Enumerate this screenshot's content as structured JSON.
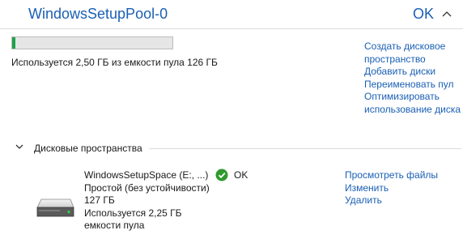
{
  "pool": {
    "name": "WindowsSetupPool-0",
    "status": "OK",
    "usage_fraction": 0.0198,
    "usage_text": "Используется 2,50 ГБ из емкости пула 126 ГБ",
    "actions": [
      "Создать дисковое пространство",
      "Добавить диски",
      "Переименовать пул",
      "Оптимизировать использование диска"
    ]
  },
  "section": {
    "title": "Дисковые пространства"
  },
  "space": {
    "name": "WindowsSetupSpace (E:, ...)",
    "resiliency": "Простой (без устойчивости)",
    "size": "127 ГБ",
    "usage": "Используется 2,25 ГБ емкости пула",
    "status": "OK",
    "actions": [
      "Просмотреть файлы",
      "Изменить",
      "Удалить"
    ]
  },
  "colors": {
    "accent": "#1a5fb4",
    "progress_fill": "#1fa34a",
    "ok_badge": "#2e9a2e"
  },
  "icons": {
    "collapse": "chevron-up-icon",
    "section": "chevron-down-icon",
    "drive": "drive-icon",
    "ok": "ok-check-icon"
  }
}
